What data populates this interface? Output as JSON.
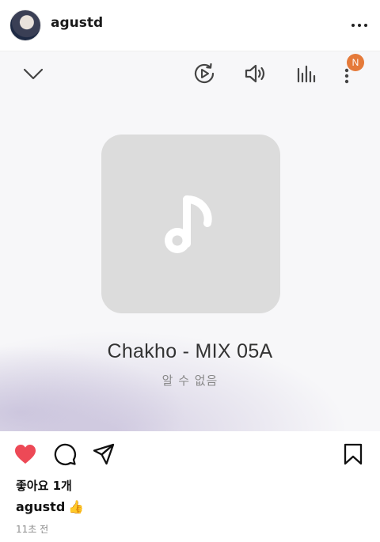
{
  "post": {
    "username": "agustd",
    "likes_text": "좋아요 1개",
    "caption_user": "agustd",
    "caption_emoji": "👍",
    "time_ago": "11초 전"
  },
  "player": {
    "notification_badge": "N",
    "track_title": "Chakho - MIX 05A",
    "track_artist": "알 수 없음"
  },
  "icons": {
    "collapse": "chevron-down-icon",
    "playback": "repeat-play-icon",
    "volume": "speaker-icon",
    "equalizer": "equalizer-icon",
    "menu": "vertical-dots-icon",
    "more": "horizontal-dots-icon",
    "like": "heart-icon",
    "comment": "comment-icon",
    "share": "send-icon",
    "save": "bookmark-icon",
    "album": "music-note-icon"
  },
  "colors": {
    "like": "#ed4956",
    "badge": "#e57a3a",
    "album_bg": "#dcdcdc"
  }
}
